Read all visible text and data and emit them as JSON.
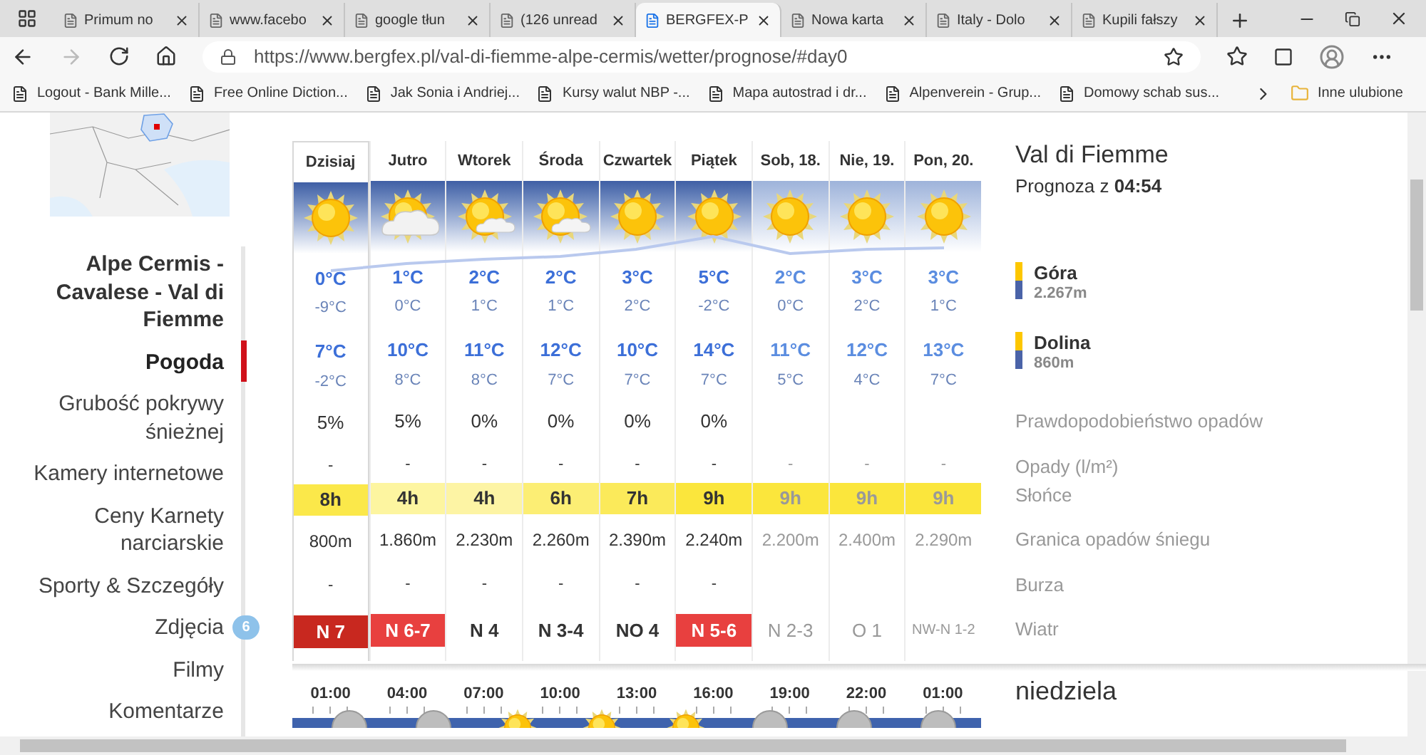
{
  "browser": {
    "tabs": [
      {
        "title": "Primum no",
        "selected": false
      },
      {
        "title": "www.facebo",
        "selected": false
      },
      {
        "title": "google tłun",
        "selected": false
      },
      {
        "title": "(126 unread",
        "selected": false
      },
      {
        "title": "BERGFEX-P",
        "selected": true
      },
      {
        "title": "Nowa karta",
        "selected": false
      },
      {
        "title": "Italy - Dolo",
        "selected": false
      },
      {
        "title": "Kupili fałszy",
        "selected": false
      }
    ],
    "url": "https://www.bergfex.pl/val-di-fiemme-alpe-cermis/wetter/prognose/#day0",
    "bookmarks": [
      "Logout - Bank Mille...",
      "Free Online Diction...",
      "Jak Sonia i Andriej...",
      "Kursy walut NBP -...",
      "Mapa autostrad i dr...",
      "Alpenverein - Grup...",
      "Domowy schab sus..."
    ],
    "other_bookmarks": "Inne ulubione"
  },
  "sidebar": {
    "resort_name": "Alpe Cermis - Cavalese - Val di Fiemme",
    "items": [
      {
        "label": "Pogoda",
        "selected": true
      },
      {
        "label": "Grubość pokrywy śnieżnej",
        "selected": false
      },
      {
        "label": "Kamery internetowe",
        "selected": false
      },
      {
        "label": "Ceny Karnety narciarskie",
        "selected": false
      },
      {
        "label": "Sporty & Szczegóły",
        "selected": false
      },
      {
        "label": "Zdjęcia",
        "selected": false,
        "badge": "6"
      },
      {
        "label": "Filmy",
        "selected": false
      },
      {
        "label": "Komentarze",
        "selected": false
      }
    ]
  },
  "forecast": {
    "days": [
      {
        "day": "Dzisiaj",
        "selected": true,
        "dimmed": false,
        "kind": "sunny",
        "max_mountain": "0°C",
        "min_mountain": "-9°C",
        "max_valley": "7°C",
        "min_valley": "-2°C",
        "precip_probability": "5%",
        "precip": "-",
        "sun": {
          "text": "8h",
          "color": "#fbe84a"
        },
        "snowline": "800m",
        "storm": "-",
        "wind": {
          "text": "N 7",
          "kind": "severe"
        }
      },
      {
        "day": "Jutro",
        "selected": false,
        "dimmed": false,
        "kind": "cloudy",
        "max_mountain": "1°C",
        "min_mountain": "0°C",
        "max_valley": "10°C",
        "min_valley": "8°C",
        "precip_probability": "5%",
        "precip": "-",
        "sun": {
          "text": "4h",
          "color": "#fdf5a0"
        },
        "snowline": "1.860m",
        "storm": "-",
        "wind": {
          "text": "N 6-7",
          "kind": "strong"
        }
      },
      {
        "day": "Wtorek",
        "selected": false,
        "dimmed": false,
        "kind": "partly",
        "max_mountain": "2°C",
        "min_mountain": "1°C",
        "max_valley": "11°C",
        "min_valley": "8°C",
        "precip_probability": "0%",
        "precip": "-",
        "sun": {
          "text": "4h",
          "color": "#fdf4a4"
        },
        "snowline": "2.230m",
        "storm": "-",
        "wind": {
          "text": "N 4",
          "kind": "calm"
        }
      },
      {
        "day": "Środa",
        "selected": false,
        "dimmed": false,
        "kind": "partly",
        "max_mountain": "2°C",
        "min_mountain": "1°C",
        "max_valley": "12°C",
        "min_valley": "7°C",
        "precip_probability": "0%",
        "precip": "-",
        "sun": {
          "text": "6h",
          "color": "#fcee74"
        },
        "snowline": "2.260m",
        "storm": "-",
        "wind": {
          "text": "N 3-4",
          "kind": "calm"
        }
      },
      {
        "day": "Czwartek",
        "selected": false,
        "dimmed": false,
        "kind": "sunny",
        "max_mountain": "3°C",
        "min_mountain": "2°C",
        "max_valley": "10°C",
        "min_valley": "7°C",
        "precip_probability": "0%",
        "precip": "-",
        "sun": {
          "text": "7h",
          "color": "#fbea5a"
        },
        "snowline": "2.390m",
        "storm": "-",
        "wind": {
          "text": "NO 4",
          "kind": "calm"
        }
      },
      {
        "day": "Piątek",
        "selected": false,
        "dimmed": false,
        "kind": "sunny",
        "max_mountain": "5°C",
        "min_mountain": "-2°C",
        "max_valley": "14°C",
        "min_valley": "7°C",
        "precip_probability": "0%",
        "precip": "-",
        "sun": {
          "text": "9h",
          "color": "#fbe63c"
        },
        "snowline": "2.240m",
        "storm": "-",
        "wind": {
          "text": "N 5-6",
          "kind": "strong"
        }
      },
      {
        "day": "Sob, 18.",
        "selected": false,
        "dimmed": true,
        "kind": "sunny",
        "max_mountain": "2°C",
        "min_mountain": "0°C",
        "max_valley": "11°C",
        "min_valley": "5°C",
        "precip": "-",
        "sun": {
          "text": "9h",
          "color": "#fbe63c"
        },
        "snowline": "2.200m",
        "wind": {
          "text": "N 2-3",
          "kind": "calm"
        }
      },
      {
        "day": "Nie, 19.",
        "selected": false,
        "dimmed": true,
        "kind": "sunny",
        "max_mountain": "3°C",
        "min_mountain": "2°C",
        "max_valley": "12°C",
        "min_valley": "4°C",
        "precip": "-",
        "sun": {
          "text": "9h",
          "color": "#fbe63c"
        },
        "snowline": "2.400m",
        "wind": {
          "text": "O 1",
          "kind": "calm"
        }
      },
      {
        "day": "Pon, 20.",
        "selected": false,
        "dimmed": true,
        "kind": "sunny",
        "max_mountain": "3°C",
        "min_mountain": "1°C",
        "max_valley": "13°C",
        "min_valley": "7°C",
        "precip": "-",
        "sun": {
          "text": "9h",
          "color": "#fbe63c"
        },
        "snowline": "2.290m",
        "wind": {
          "text": "NW-N 1-2",
          "kind": "calm"
        }
      }
    ],
    "title": "Val di Fiemme",
    "issued_label": "Prognoza z",
    "issued_time": "04:54",
    "levels": [
      {
        "name": "Góra",
        "altitude": "2.267m"
      },
      {
        "name": "Dolina",
        "altitude": "860m"
      }
    ],
    "row_labels": [
      "Prawdopodobieństwo opadów",
      "Opady (l/m²)",
      "Słońce",
      "Granica opadów śniegu",
      "Burza",
      "Wiatr"
    ]
  },
  "hourly": {
    "day": "niedziela",
    "times": [
      "01:00",
      "04:00",
      "07:00",
      "10:00",
      "13:00",
      "16:00",
      "19:00",
      "22:00",
      "01:00"
    ],
    "icons": [
      {
        "kind": "moon"
      },
      {
        "kind": "moon"
      },
      {
        "kind": "sun"
      },
      {
        "kind": "sun"
      },
      {
        "kind": "sun"
      },
      {
        "kind": "moon"
      },
      {
        "kind": "moon"
      },
      {
        "kind": "moon"
      }
    ]
  }
}
